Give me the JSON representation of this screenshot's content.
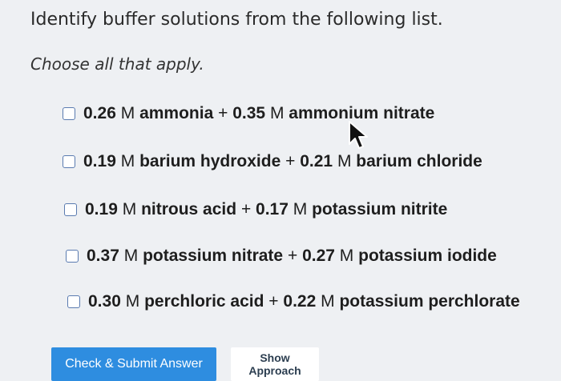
{
  "question": {
    "prompt": "Identify buffer solutions from the following list.",
    "instruction": "Choose all that apply."
  },
  "options": [
    {
      "checked": false,
      "c1": "0.26",
      "unit1": "M",
      "s1": "ammonia",
      "op": "+",
      "c2": "0.35",
      "unit2": "M",
      "s2": "ammonium nitrate"
    },
    {
      "checked": false,
      "c1": "0.19",
      "unit1": "M",
      "s1": "barium hydroxide",
      "op": "+",
      "c2": "0.21",
      "unit2": "M",
      "s2": "barium chloride"
    },
    {
      "checked": false,
      "c1": "0.19",
      "unit1": "M",
      "s1": "nitrous acid",
      "op": "+",
      "c2": "0.17",
      "unit2": "M",
      "s2": "potassium nitrite"
    },
    {
      "checked": false,
      "c1": "0.37",
      "unit1": "M",
      "s1": "potassium nitrate",
      "op": "+",
      "c2": "0.27",
      "unit2": "M",
      "s2": "potassium iodide"
    },
    {
      "checked": false,
      "c1": "0.30",
      "unit1": "M",
      "s1": "perchloric acid",
      "op": "+",
      "c2": "0.22",
      "unit2": "M",
      "s2": "potassium perchlorate"
    }
  ],
  "buttons": {
    "submit_label": "Check & Submit Answer",
    "approach_label": "Show Approach"
  },
  "colors": {
    "submit_bg": "#2e8de0",
    "checkbox_border": "#5a7bb0",
    "page_bg": "#eef0f3"
  },
  "icons": {
    "cursor": "mouse-pointer-icon"
  }
}
